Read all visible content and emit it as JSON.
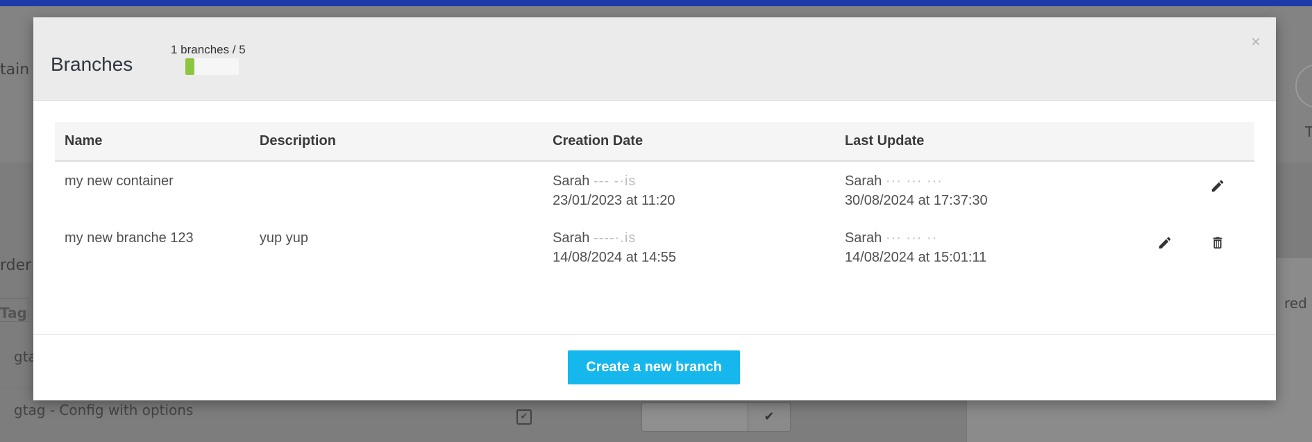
{
  "background": {
    "left_title_fragment": "tain",
    "left_section_fragment": "rder",
    "tag_header_fragment": "Tag",
    "row1_fragment": "gtag",
    "row2_text": "gtag - Config with options",
    "right_text_fragment": "red",
    "right_header_fragment": "T"
  },
  "modal": {
    "title": "Branches",
    "quota": {
      "label": "1 branches / 5",
      "used": 1,
      "max": 5
    },
    "close_symbol": "×",
    "table": {
      "headers": {
        "name": "Name",
        "description": "Description",
        "creation": "Creation Date",
        "update": "Last Update"
      },
      "rows": [
        {
          "name": "my new container",
          "description": "",
          "creation_user": "Sarah",
          "creation_user_rest": "--- -·is",
          "creation_date": "23/01/2023 at 11:20",
          "update_user": "Sarah",
          "update_user_rest": "··· ··· ···",
          "update_date": "30/08/2024 at 17:37:30"
        },
        {
          "name": "my new branche 123",
          "description": "yup yup",
          "creation_user": "Sarah",
          "creation_user_rest": "----·.is",
          "creation_date": "14/08/2024 at 14:55",
          "update_user": "Sarah",
          "update_user_rest": "··· ··· ··",
          "update_date": "14/08/2024 at 15:01:11"
        }
      ]
    },
    "create_button_label": "Create a new branch"
  },
  "colors": {
    "accent": "#16b7ec",
    "quota_fill": "#8cc63f",
    "topbar": "#1e3aa8"
  },
  "icons": [
    "pencil-icon",
    "trash-icon",
    "close-icon"
  ]
}
